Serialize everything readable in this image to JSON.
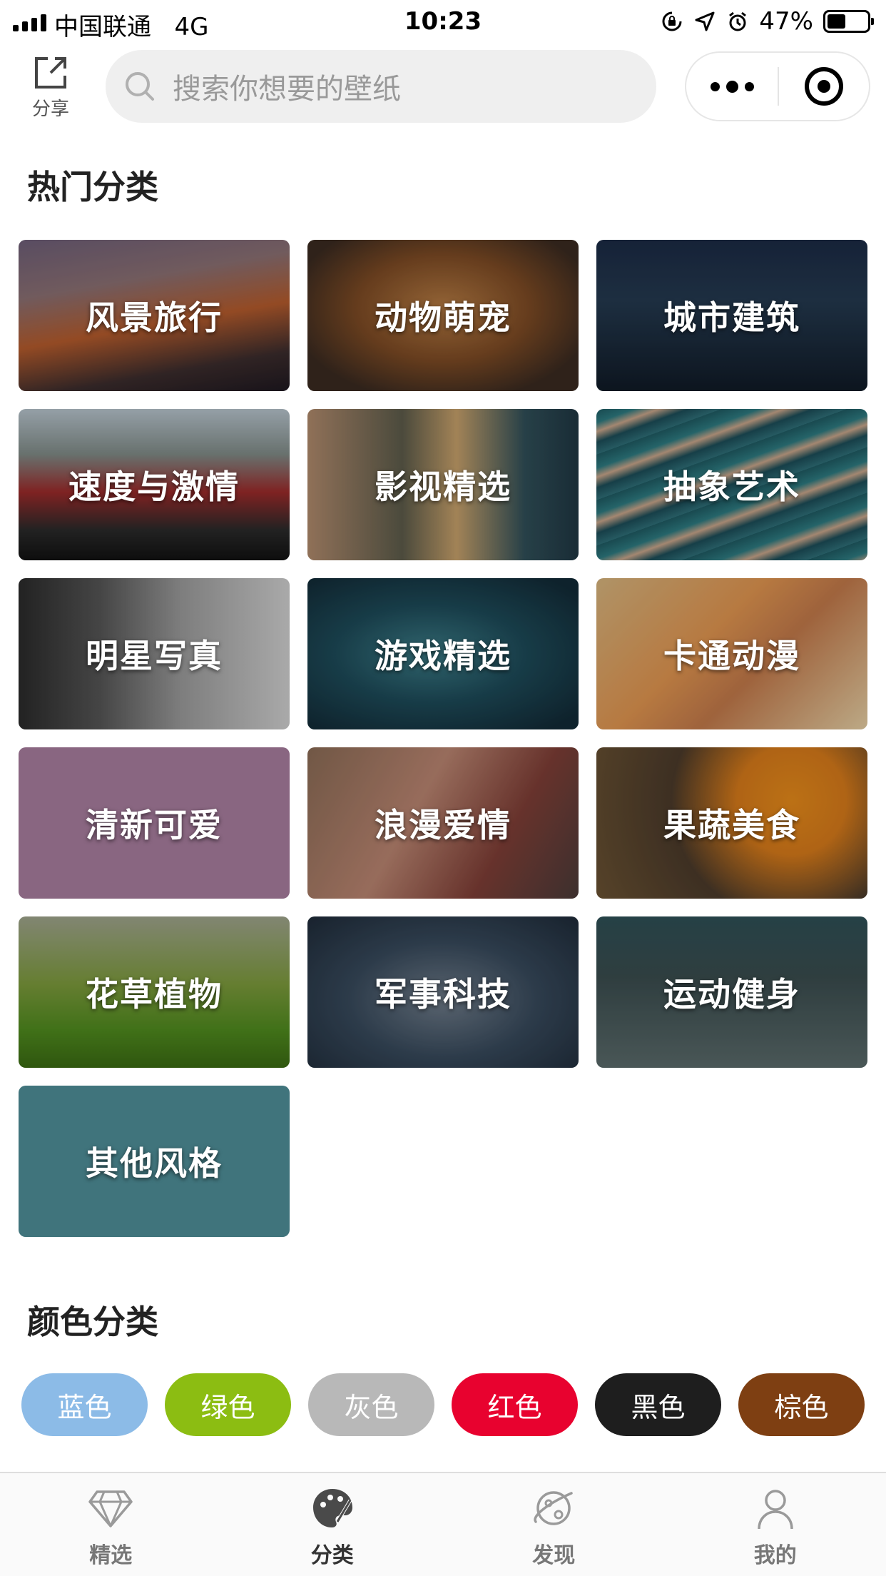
{
  "status_bar": {
    "carrier": "中国联通",
    "network": "4G",
    "time": "10:23",
    "battery": "47%",
    "battery_level": 0.47
  },
  "nav": {
    "share_label": "分享",
    "search_placeholder": "搜索你想要的壁纸"
  },
  "hot_categories": {
    "title": "热门分类",
    "items": [
      {
        "label": "风景旅行"
      },
      {
        "label": "动物萌宠"
      },
      {
        "label": "城市建筑"
      },
      {
        "label": "速度与激情"
      },
      {
        "label": "影视精选"
      },
      {
        "label": "抽象艺术"
      },
      {
        "label": "明星写真"
      },
      {
        "label": "游戏精选"
      },
      {
        "label": "卡通动漫"
      },
      {
        "label": "清新可爱"
      },
      {
        "label": "浪漫爱情"
      },
      {
        "label": "果蔬美食"
      },
      {
        "label": "花草植物"
      },
      {
        "label": "军事科技"
      },
      {
        "label": "运动健身"
      },
      {
        "label": "其他风格"
      }
    ]
  },
  "color_categories": {
    "title": "颜色分类",
    "items": [
      {
        "label": "蓝色",
        "color": "#8cbbe7"
      },
      {
        "label": "绿色",
        "color": "#8cbd12"
      },
      {
        "label": "灰色",
        "color": "#b8b8b8"
      },
      {
        "label": "红色",
        "color": "#e8022f"
      },
      {
        "label": "黑色",
        "color": "#1e1e1e"
      },
      {
        "label": "棕色",
        "color": "#7e3f12"
      }
    ]
  },
  "tab_bar": {
    "items": [
      {
        "label": "精选",
        "icon": "diamond-icon",
        "active": false
      },
      {
        "label": "分类",
        "icon": "palette-icon",
        "active": true
      },
      {
        "label": "发现",
        "icon": "planet-icon",
        "active": false
      },
      {
        "label": "我的",
        "icon": "person-icon",
        "active": false
      }
    ]
  }
}
